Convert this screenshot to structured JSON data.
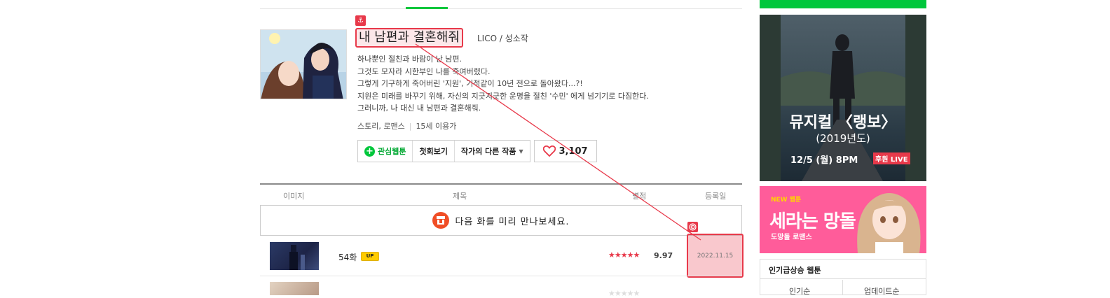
{
  "comic": {
    "title": "내 남편과 결혼해줘",
    "author": "LICO / 성소작",
    "description": [
      "하나뿐인 절친과 바람이 난 남편.",
      "그것도 모자라 시한부인 나를 죽여버렸다.",
      "그렇게 기구하게 죽어버린 '지원', 기적같이 10년 전으로 돌아왔다...?!",
      "지원은 미래를 바꾸기 위해, 자신의 지긋지긋한 운명을 절친 '수민' 에게 넘기기로 다짐한다.",
      "그러니까, 나 대신 내 남편과 결혼해줘."
    ],
    "genre": "스토리, 로맨스",
    "age": "15세 이용가"
  },
  "buttons": {
    "favorite": "관심웹툰",
    "first_episode": "첫회보기",
    "other_works": "작가의 다른 작품",
    "likes": "3,107"
  },
  "table": {
    "headers": {
      "image": "이미지",
      "title": "제목",
      "rating": "별점",
      "date": "등록일"
    },
    "preview_text": "다음 화를 미리 만나보세요.",
    "episodes": [
      {
        "title": "54화",
        "badge": "UP",
        "stars": "★★★★★",
        "rating": "9.97",
        "date": "2022.11.15"
      }
    ]
  },
  "sidebar": {
    "ad1": {
      "title": "뮤지컬 〈랭보〉",
      "subtitle": "(2019년도)",
      "date": "12/5 (월) 8PM",
      "badge": "후원 LIVE"
    },
    "ad2": {
      "new_label": "NEW 웹툰",
      "title": "세라는 망돌",
      "genre": "도망돌 로맨스"
    },
    "ranking": {
      "title": "인기급상승 웹툰",
      "tabs": [
        "인기순",
        "업데이트순"
      ]
    }
  },
  "colors": {
    "brand_green": "#00c73c",
    "annotation_red": "#e8394a",
    "star_red": "#e8394a"
  }
}
